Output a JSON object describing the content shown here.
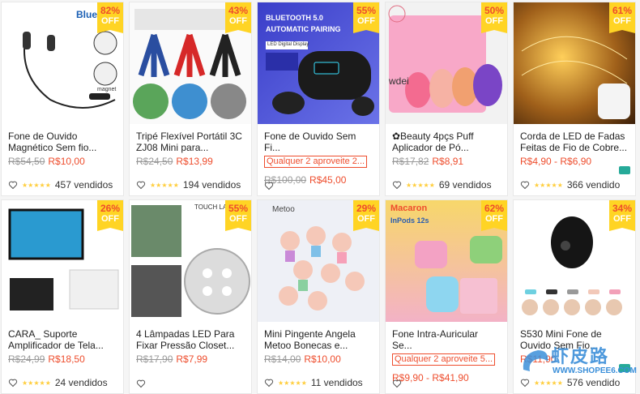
{
  "products": [
    {
      "title": "Fone de Ouvido Magnético Sem fio...",
      "old": "R$54,50",
      "new": "R$10,00",
      "promo": "",
      "sold": "457 vendidos",
      "pct": "82%",
      "off": "OFF",
      "img_text": "Blue",
      "img_text2": "magnet"
    },
    {
      "title": "Tripé Flexível Portátil 3C ZJ08 Mini para...",
      "old": "R$24,50",
      "new": "R$13,99",
      "promo": "",
      "sold": "194 vendidos",
      "pct": "43%",
      "off": "OFF",
      "img_text": "",
      "img_text2": ""
    },
    {
      "title": "Fone de Ouvido Sem Fi...",
      "old": "R$100,00",
      "new": "R$45,00",
      "promo": "Qualquer 2 aproveite 2...",
      "sold": "",
      "pct": "55%",
      "off": "OFF",
      "img_text": "BLUETOOTH 5.0",
      "img_text2": "AUTOMATIC PAIRING",
      "img_text3": "LED Digital Display"
    },
    {
      "title": "✿Beauty 4pçs Puff Aplicador de Pó...",
      "old": "R$17,82",
      "new": "R$8,91",
      "promo": "",
      "sold": "69 vendidos",
      "pct": "50%",
      "off": "OFF",
      "img_text": "wdei",
      "img_text2": ""
    },
    {
      "title": "Corda de LED de Fadas Feitas de Fio de Cobre...",
      "old": "",
      "new": "R$4,90 - R$6,90",
      "promo": "",
      "sold": "366 vendido",
      "pct": "61%",
      "off": "OFF",
      "img_text": "",
      "img_text2": ""
    },
    {
      "title": "CARA_ Suporte Amplificador de Tela...",
      "old": "R$24,99",
      "new": "R$18,50",
      "promo": "",
      "sold": "24 vendidos",
      "pct": "26%",
      "off": "OFF",
      "img_text": "",
      "img_text2": ""
    },
    {
      "title": "4 Lâmpadas LED Para Fixar Pressão Closet...",
      "old": "R$17,90",
      "new": "R$7,99",
      "promo": "",
      "sold": "",
      "pct": "55%",
      "off": "OFF",
      "img_text": "TOUCH LAMP",
      "img_text2": ""
    },
    {
      "title": "Mini Pingente Angela Metoo Bonecas e...",
      "old": "R$14,00",
      "new": "R$10,00",
      "promo": "",
      "sold": "11 vendidos",
      "pct": "29%",
      "off": "OFF",
      "img_text": "Metoo",
      "img_text2": ""
    },
    {
      "title": "Fone Intra-Auricular Se...",
      "old": "",
      "new": "R$9,90 - R$41,90",
      "promo": "Qualquer 2 aproveite 5...",
      "sold": "",
      "pct": "62%",
      "off": "OFF",
      "img_text": "Macaron",
      "img_text2": "InPods 12s"
    },
    {
      "title": "S530 Mini Fone de Ouvido Sem Fio...",
      "old": "",
      "new": "R$11,90",
      "promo": "",
      "sold": "576 vendido",
      "pct": "34%",
      "off": "OFF",
      "img_text": "",
      "img_text2": ""
    }
  ],
  "watermark": {
    "cn": "虾皮路",
    "url": "WWW.SHOPEE6.COM"
  }
}
